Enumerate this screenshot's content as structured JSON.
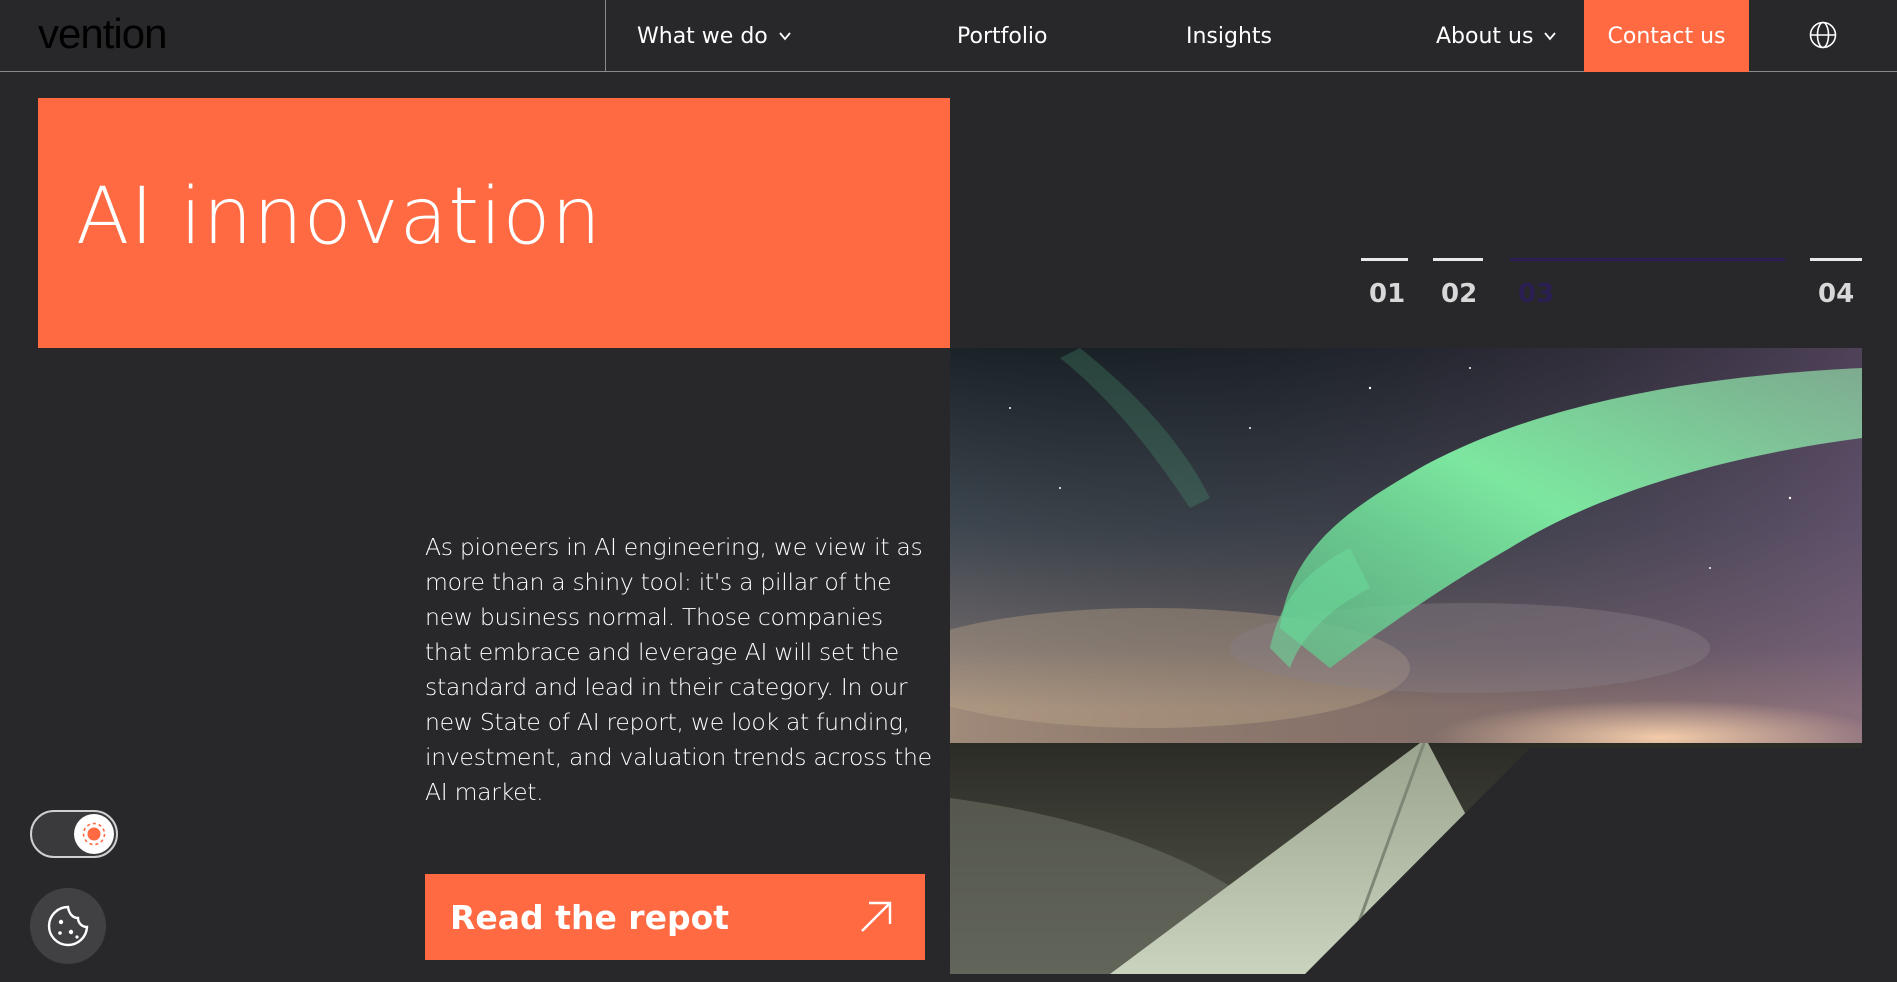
{
  "header": {
    "logo_text": "vention",
    "nav": [
      {
        "label": "What we do",
        "has_dropdown": true
      },
      {
        "label": "Portfolio",
        "has_dropdown": false
      },
      {
        "label": "Insights",
        "has_dropdown": false
      },
      {
        "label": "About us",
        "has_dropdown": true
      }
    ],
    "contact_label": "Contact us",
    "language_icon": "globe-icon"
  },
  "hero": {
    "title": "AI innovation",
    "description": "As pioneers in AI engineering, we view it as more than a shiny tool: it's a pillar of the new business normal. Those companies that embrace and leverage AI will set the standard and lead in their category. In our new State of AI report, we look at funding, investment, and valuation trends across the AI market.",
    "cta_label": "Read the repot",
    "cta_icon": "arrow-up-right-icon",
    "image_subject": "aurora-over-road"
  },
  "pager": {
    "items": [
      "01",
      "02",
      "03",
      "04"
    ],
    "active_index": 2
  },
  "controls": {
    "theme_toggle_icon": "sun-icon",
    "cookie_icon": "cookie-icon"
  },
  "colors": {
    "background": "#28282b",
    "accent": "#ff6a43",
    "pager_active": "#2a1e52",
    "text": "#ffffff"
  }
}
